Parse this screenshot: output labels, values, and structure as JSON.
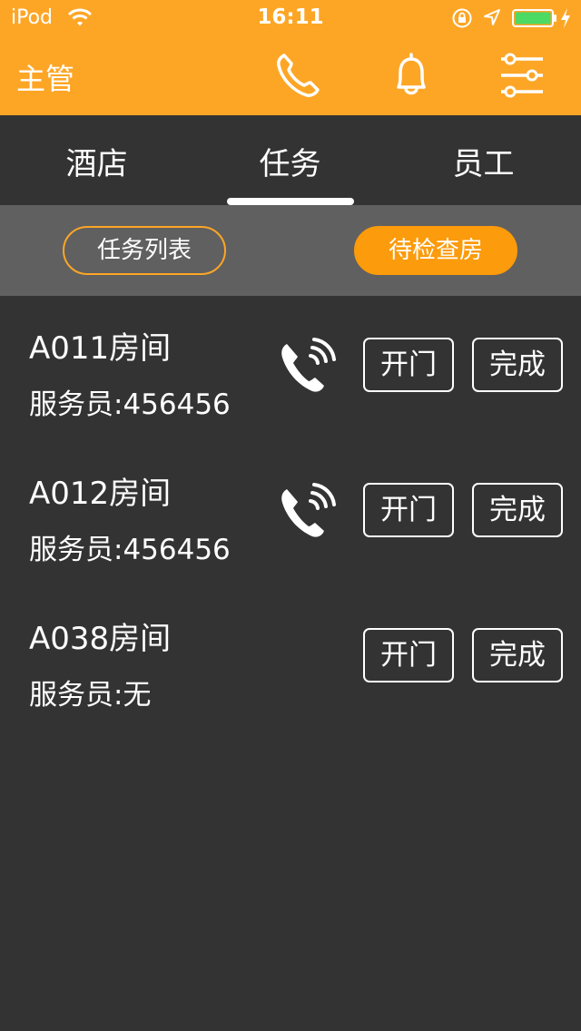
{
  "status_bar": {
    "carrier": "iPod",
    "time": "16:11"
  },
  "header": {
    "title": "主管",
    "icons": [
      "phone-icon",
      "bell-icon",
      "settings-sliders-icon"
    ],
    "background_color": "#fda626"
  },
  "tabs": [
    {
      "label": "酒店",
      "selected": false
    },
    {
      "label": "任务",
      "selected": true
    },
    {
      "label": "员工",
      "selected": false
    }
  ],
  "filters": {
    "task_list": "任务列表",
    "pending_inspection": "待检查房",
    "active": "pending_inspection",
    "accent_color": "#fc9b0b"
  },
  "rooms": [
    {
      "room": "A011房间",
      "attendant": "服务员:456456",
      "has_call": true,
      "open_label": "开门",
      "done_label": "完成"
    },
    {
      "room": "A012房间",
      "attendant": "服务员:456456",
      "has_call": true,
      "open_label": "开门",
      "done_label": "完成"
    },
    {
      "room": "A038房间",
      "attendant": "服务员:无",
      "has_call": false,
      "open_label": "开门",
      "done_label": "完成"
    }
  ]
}
